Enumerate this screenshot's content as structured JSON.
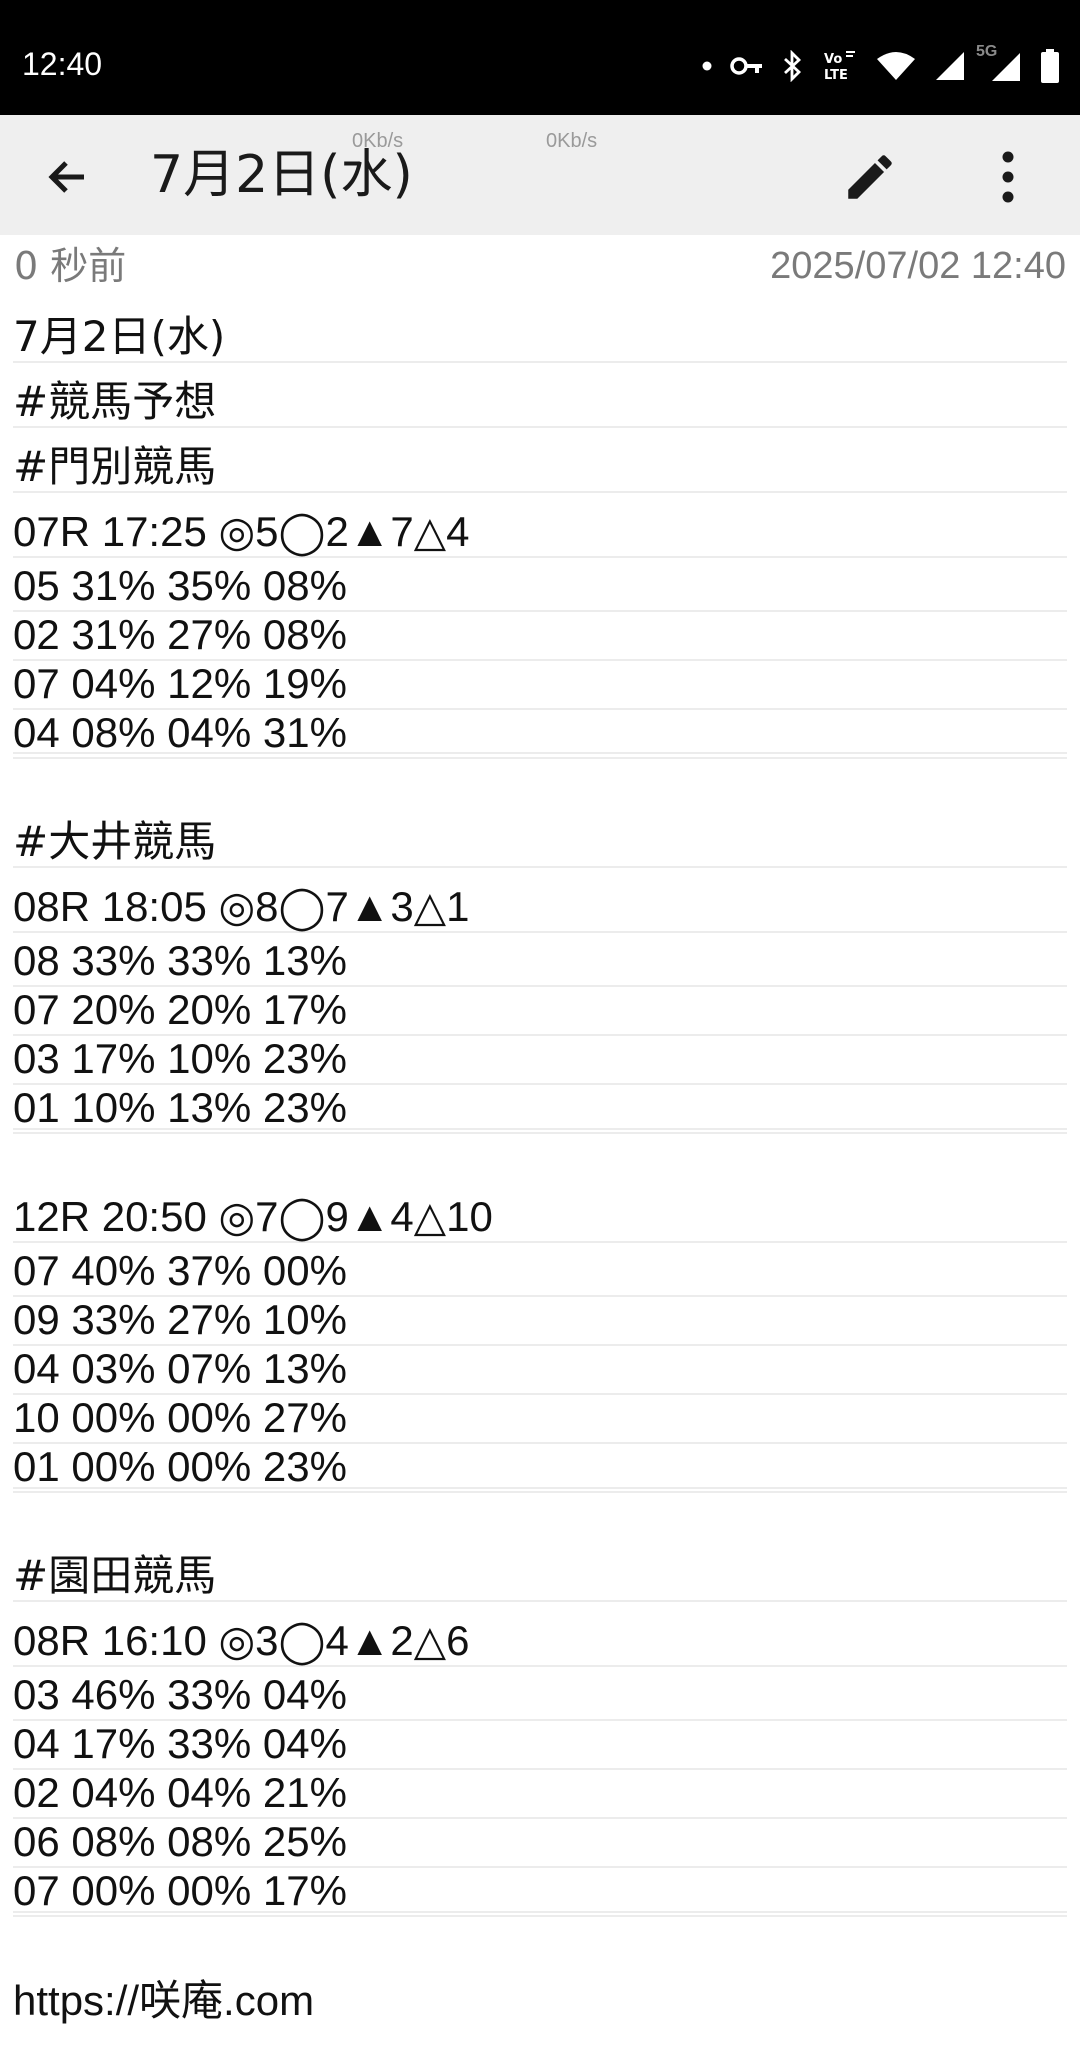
{
  "status_bar": {
    "time": "12:40",
    "network_label": "5G",
    "icons": [
      "dot-icon",
      "vpn-key-icon",
      "bluetooth-icon",
      "volte-icon",
      "wifi-icon",
      "signal-icon",
      "signal-5g-icon",
      "battery-icon"
    ]
  },
  "app_bar": {
    "title": "7月2日(水)",
    "net_speed_1": "0Kb/s",
    "net_speed_2": "0Kb/s",
    "icons": [
      "back-arrow-icon",
      "edit-pencil-icon",
      "more-vert-icon"
    ]
  },
  "meta": {
    "relative_time": "0 秒前",
    "timestamp": "2025/07/02 12:40"
  },
  "note_lines": [
    "7月2日(水)",
    "#競馬予想",
    "#門別競馬",
    "07R 17:25 ◎5◯2▲7△4",
    "05 31% 35% 08%",
    "02 31% 27% 08%",
    "07 04% 12% 19%",
    "04 08% 04% 31%",
    "",
    "#大井競馬",
    "08R 18:05 ◎8◯7▲3△1",
    "08 33% 33% 13%",
    "07 20% 20% 17%",
    "03 17% 10% 23%",
    "01 10% 13% 23%",
    "",
    "12R 20:50 ◎7◯9▲4△10",
    "07 40% 37% 00%",
    "09 33% 27% 10%",
    "04 03% 07% 13%",
    "10 00% 00% 27%",
    "01 00% 00% 23%",
    "",
    "#園田競馬",
    "08R 16:10 ◎3◯4▲2△6",
    "03 46% 33% 04%",
    "04 17% 33% 04%",
    "02 04% 04% 21%",
    "06 08% 08% 25%",
    "07 00% 00% 17%",
    "",
    "https://咲庵.com"
  ]
}
